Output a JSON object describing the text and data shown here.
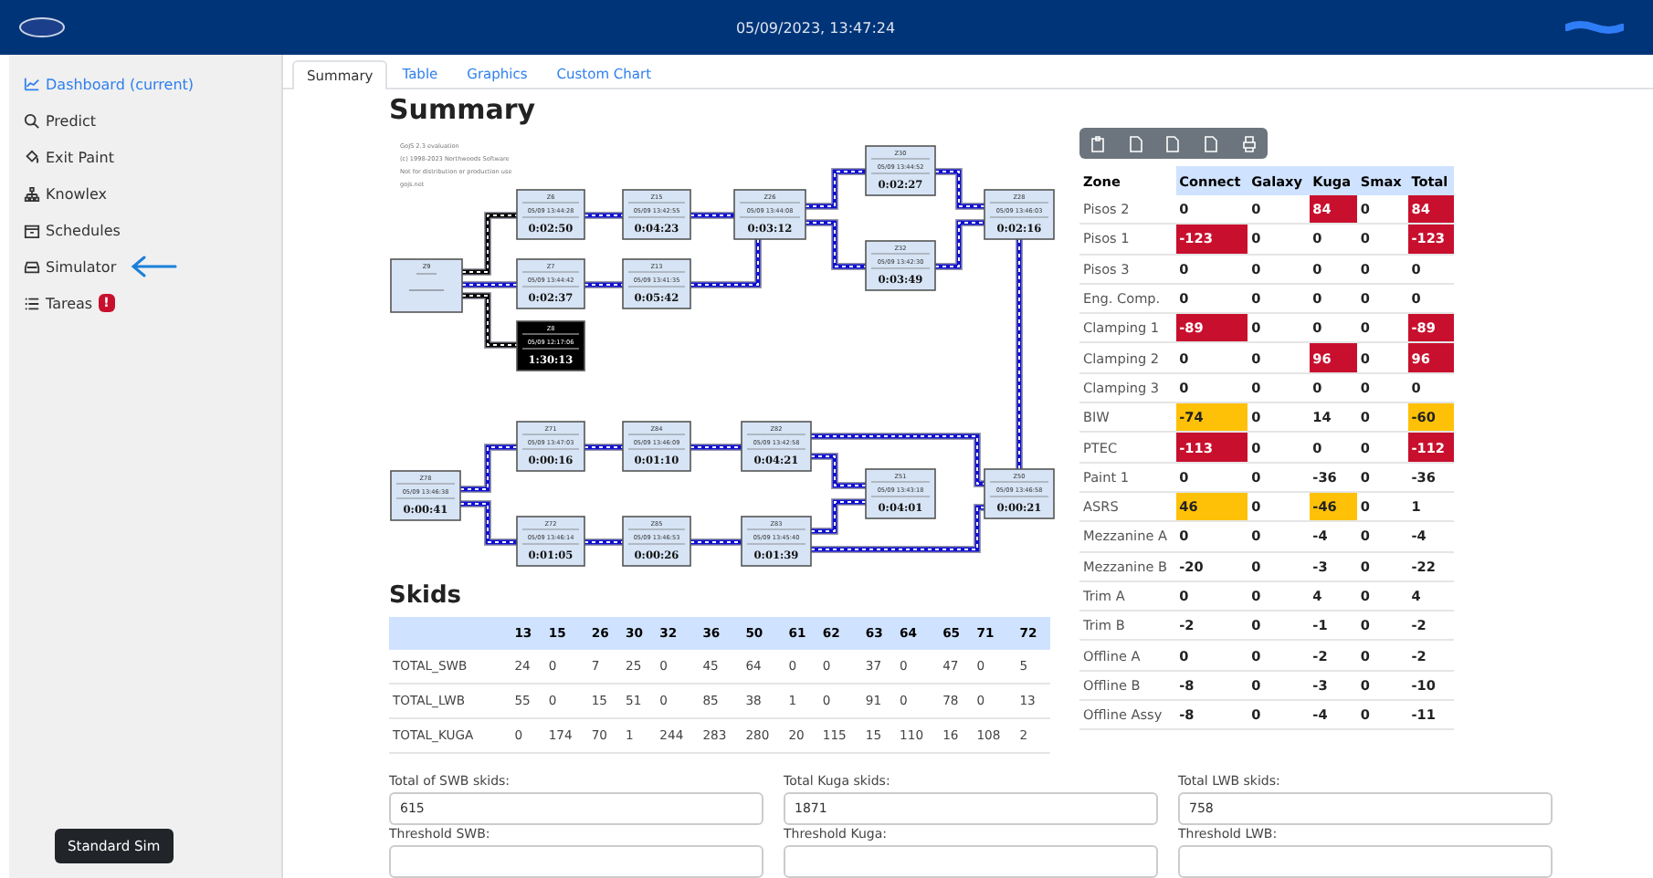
{
  "header": {
    "datetime": "05/09/2023, 13:47:24"
  },
  "sidebar": {
    "items": [
      {
        "label": "Dashboard (current)",
        "selected": true
      },
      {
        "label": "Predict",
        "selected": false
      },
      {
        "label": "Exit Paint",
        "selected": false
      },
      {
        "label": "Knowlex",
        "selected": false
      },
      {
        "label": "Schedules",
        "selected": false
      },
      {
        "label": "Simulator",
        "selected": false,
        "pointer": true
      },
      {
        "label": "Tareas",
        "selected": false,
        "badge": "!"
      }
    ],
    "button": "Standard Sim"
  },
  "tabs": [
    {
      "label": "Summary",
      "selected": true
    },
    {
      "label": "Table",
      "selected": false
    },
    {
      "label": "Graphics",
      "selected": false
    },
    {
      "label": "Custom Chart",
      "selected": false
    }
  ],
  "summary": {
    "title": "Summary",
    "diagram": {
      "watermark": [
        "GoJS 2.3 evaluation",
        "(c) 1998-2023 Northwoods Software",
        "Not for distribution or production use",
        "gojs.net"
      ],
      "nodes": [
        {
          "id": "Z9",
          "kind": "source"
        },
        {
          "id": "Z6",
          "time": "05/09 13:44:28",
          "duration": "0:02:50",
          "alert": false
        },
        {
          "id": "Z15",
          "time": "05/09 13:42:55",
          "duration": "0:04:23",
          "alert": false
        },
        {
          "id": "Z26",
          "time": "05/09 13:44:08",
          "duration": "0:03:12",
          "alert": false
        },
        {
          "id": "Z30",
          "time": "05/09 13:44:52",
          "duration": "0:02:27",
          "alert": false
        },
        {
          "id": "Z28",
          "time": "05/09 13:46:03",
          "duration": "0:02:16",
          "alert": false
        },
        {
          "id": "Z32",
          "time": "05/09 13:42:30",
          "duration": "0:03:49",
          "alert": false
        },
        {
          "id": "Z7",
          "time": "05/09 13:44:42",
          "duration": "0:02:37",
          "alert": false
        },
        {
          "id": "Z13",
          "time": "05/09 13:41:35",
          "duration": "0:05:42",
          "alert": false
        },
        {
          "id": "Z8",
          "time": "05/09 12:17:06",
          "duration": "1:30:13",
          "alert": true
        },
        {
          "id": "Z78",
          "time": "05/09 13:46:38",
          "duration": "0:00:41",
          "alert": false
        },
        {
          "id": "Z71",
          "time": "05/09 13:47:03",
          "duration": "0:00:16",
          "alert": false
        },
        {
          "id": "Z84",
          "time": "05/09 13:46:09",
          "duration": "0:01:10",
          "alert": false
        },
        {
          "id": "Z82",
          "time": "05/09 13:42:58",
          "duration": "0:04:21",
          "alert": false
        },
        {
          "id": "Z51",
          "time": "05/09 13:43:18",
          "duration": "0:04:01",
          "alert": false
        },
        {
          "id": "Z50",
          "time": "05/09 13:46:58",
          "duration": "0:00:21",
          "alert": false
        },
        {
          "id": "Z72",
          "time": "05/09 13:46:14",
          "duration": "0:01:05",
          "alert": false
        },
        {
          "id": "Z85",
          "time": "05/09 13:46:53",
          "duration": "0:00:26",
          "alert": false
        },
        {
          "id": "Z83",
          "time": "05/09 13:45:40",
          "duration": "0:01:39",
          "alert": false
        }
      ]
    }
  },
  "zones": {
    "columns": [
      "Zone",
      "Connect",
      "Galaxy",
      "Kuga",
      "Smax",
      "Total"
    ],
    "rows": [
      {
        "cells": [
          {
            "value": "Pisos 2"
          },
          {
            "value": "0"
          },
          {
            "value": "0"
          },
          {
            "value": "84",
            "color": "#c8102e"
          },
          {
            "value": "0"
          },
          {
            "value": "84",
            "color": "#c8102e"
          }
        ]
      },
      {
        "cells": [
          {
            "value": "Pisos 1"
          },
          {
            "value": "-123",
            "color": "#c8102e"
          },
          {
            "value": "0"
          },
          {
            "value": "0"
          },
          {
            "value": "0"
          },
          {
            "value": "-123",
            "color": "#c8102e"
          }
        ]
      },
      {
        "cells": [
          {
            "value": "Pisos 3"
          },
          {
            "value": "0"
          },
          {
            "value": "0"
          },
          {
            "value": "0"
          },
          {
            "value": "0"
          },
          {
            "value": "0"
          }
        ]
      },
      {
        "cells": [
          {
            "value": "Eng. Comp."
          },
          {
            "value": "0"
          },
          {
            "value": "0"
          },
          {
            "value": "0"
          },
          {
            "value": "0"
          },
          {
            "value": "0"
          }
        ]
      },
      {
        "cells": [
          {
            "value": "Clamping 1"
          },
          {
            "value": "-89",
            "color": "#c8102e"
          },
          {
            "value": "0"
          },
          {
            "value": "0"
          },
          {
            "value": "0"
          },
          {
            "value": "-89",
            "color": "#c8102e"
          }
        ]
      },
      {
        "cells": [
          {
            "value": "Clamping 2"
          },
          {
            "value": "0"
          },
          {
            "value": "0"
          },
          {
            "value": "96",
            "color": "#c8102e"
          },
          {
            "value": "0"
          },
          {
            "value": "96",
            "color": "#c8102e"
          }
        ]
      },
      {
        "cells": [
          {
            "value": "Clamping 3"
          },
          {
            "value": "0"
          },
          {
            "value": "0"
          },
          {
            "value": "0"
          },
          {
            "value": "0"
          },
          {
            "value": "0"
          }
        ]
      },
      {
        "cells": [
          {
            "value": "BIW"
          },
          {
            "value": "-74",
            "color": "#ffc107"
          },
          {
            "value": "0"
          },
          {
            "value": "14"
          },
          {
            "value": "0"
          },
          {
            "value": "-60",
            "color": "#ffc107"
          }
        ]
      },
      {
        "cells": [
          {
            "value": "PTEC"
          },
          {
            "value": "-113",
            "color": "#c8102e"
          },
          {
            "value": "0"
          },
          {
            "value": "0"
          },
          {
            "value": "0"
          },
          {
            "value": "-112",
            "color": "#c8102e"
          }
        ]
      },
      {
        "cells": [
          {
            "value": "Paint 1"
          },
          {
            "value": "0"
          },
          {
            "value": "0"
          },
          {
            "value": "-36"
          },
          {
            "value": "0"
          },
          {
            "value": "-36"
          }
        ]
      },
      {
        "cells": [
          {
            "value": "ASRS"
          },
          {
            "value": "46",
            "color": "#ffc107"
          },
          {
            "value": "0"
          },
          {
            "value": "-46",
            "color": "#ffc107"
          },
          {
            "value": "0"
          },
          {
            "value": "1"
          }
        ]
      },
      {
        "cells": [
          {
            "value": "Mezzanine A"
          },
          {
            "value": "0"
          },
          {
            "value": "0"
          },
          {
            "value": "-4"
          },
          {
            "value": "0"
          },
          {
            "value": "-4"
          }
        ]
      },
      {
        "cells": [
          {
            "value": "Mezzanine B"
          },
          {
            "value": "-20"
          },
          {
            "value": "0"
          },
          {
            "value": "-3"
          },
          {
            "value": "0"
          },
          {
            "value": "-22"
          }
        ]
      },
      {
        "cells": [
          {
            "value": "Trim A"
          },
          {
            "value": "0"
          },
          {
            "value": "0"
          },
          {
            "value": "4"
          },
          {
            "value": "0"
          },
          {
            "value": "4"
          }
        ]
      },
      {
        "cells": [
          {
            "value": "Trim B"
          },
          {
            "value": "-2"
          },
          {
            "value": "0"
          },
          {
            "value": "-1"
          },
          {
            "value": "0"
          },
          {
            "value": "-2"
          }
        ]
      },
      {
        "cells": [
          {
            "value": "Offline A"
          },
          {
            "value": "0"
          },
          {
            "value": "0"
          },
          {
            "value": "-2"
          },
          {
            "value": "0"
          },
          {
            "value": "-2"
          }
        ]
      },
      {
        "cells": [
          {
            "value": "Offline B"
          },
          {
            "value": "-8"
          },
          {
            "value": "0"
          },
          {
            "value": "-3"
          },
          {
            "value": "0"
          },
          {
            "value": "-10"
          }
        ]
      },
      {
        "cells": [
          {
            "value": "Offline Assy"
          },
          {
            "value": "-8"
          },
          {
            "value": "0"
          },
          {
            "value": "-4"
          },
          {
            "value": "0"
          },
          {
            "value": "-11"
          }
        ]
      }
    ]
  },
  "skids": {
    "title": "Skids",
    "columns": [
      "13",
      "15",
      "26",
      "30",
      "32",
      "36",
      "50",
      "61",
      "62",
      "63",
      "64",
      "65",
      "71",
      "72"
    ],
    "rows": [
      {
        "label": "TOTAL_SWB",
        "values": [
          "24",
          "0",
          "7",
          "25",
          "0",
          "45",
          "64",
          "0",
          "0",
          "37",
          "0",
          "47",
          "0",
          "5"
        ]
      },
      {
        "label": "TOTAL_LWB",
        "values": [
          "55",
          "0",
          "15",
          "51",
          "0",
          "85",
          "38",
          "1",
          "0",
          "91",
          "0",
          "78",
          "0",
          "13"
        ]
      },
      {
        "label": "TOTAL_KUGA",
        "values": [
          "0",
          "174",
          "70",
          "1",
          "244",
          "283",
          "280",
          "20",
          "115",
          "15",
          "110",
          "16",
          "108",
          "2"
        ]
      }
    ]
  },
  "fields": [
    {
      "label": "Total of SWB skids:",
      "value": "615"
    },
    {
      "label": "Total Kuga skids:",
      "value": "1871"
    },
    {
      "label": "Total LWB skids:",
      "value": "758"
    },
    {
      "label": "Threshold SWB:"
    },
    {
      "label": "Threshold Kuga:"
    },
    {
      "label": "Threshold LWB:"
    }
  ]
}
